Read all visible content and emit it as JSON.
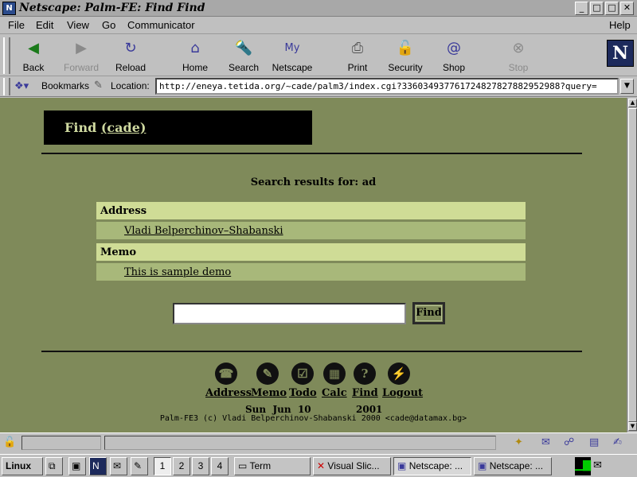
{
  "window": {
    "title": "Netscape: Palm-FE: Find Find",
    "controls": [
      "_",
      "□",
      "□",
      "✕"
    ]
  },
  "menu": {
    "file": "File",
    "edit": "Edit",
    "view": "View",
    "go": "Go",
    "communicator": "Communicator",
    "help": "Help"
  },
  "toolbar": {
    "back": "Back",
    "forward": "Forward",
    "reload": "Reload",
    "home": "Home",
    "search": "Search",
    "netscape": "Netscape",
    "print": "Print",
    "security": "Security",
    "shop": "Shop",
    "stop": "Stop"
  },
  "location_bar": {
    "bookmarks_label": "Bookmarks",
    "location_label": "Location:",
    "url": "http://eneya.tetida.org/~cade/palm3/index.cgi?33603493776172482782788295298​8?query="
  },
  "page": {
    "header_title": "Find",
    "header_user": "(cade)",
    "search_results_label": "Search results for: ad",
    "sections": [
      {
        "name": "Address",
        "items": [
          "Vladi Belperchinov–Shabanski"
        ]
      },
      {
        "name": "Memo",
        "items": [
          "This is sample demo"
        ]
      }
    ],
    "find_input_value": "",
    "find_button": "Find",
    "nav": {
      "address": "Address",
      "memo": "Memo",
      "todo": "Todo",
      "calc": "Calc",
      "find": "Find",
      "logout": "Logout"
    },
    "date_line": "Sun  Jun  10",
    "year": "2001",
    "copyright": "Palm-FE3 (c) Vladi Belperchinov-Shabanski 2000 <cade@datamax.bg>"
  },
  "taskbar": {
    "linux_label": "Linux",
    "desktops": [
      "1",
      "2",
      "3",
      "4"
    ],
    "tasks": [
      "Term",
      "Visual Slic...",
      "Netscape: ...",
      "Netscape: ..."
    ]
  },
  "colors": {
    "page_bg": "#7f8a5a",
    "section_bg": "#cfdc96",
    "row_bg": "#a8b87a",
    "header_box": "#000000",
    "header_text": "#cfd9a0"
  }
}
